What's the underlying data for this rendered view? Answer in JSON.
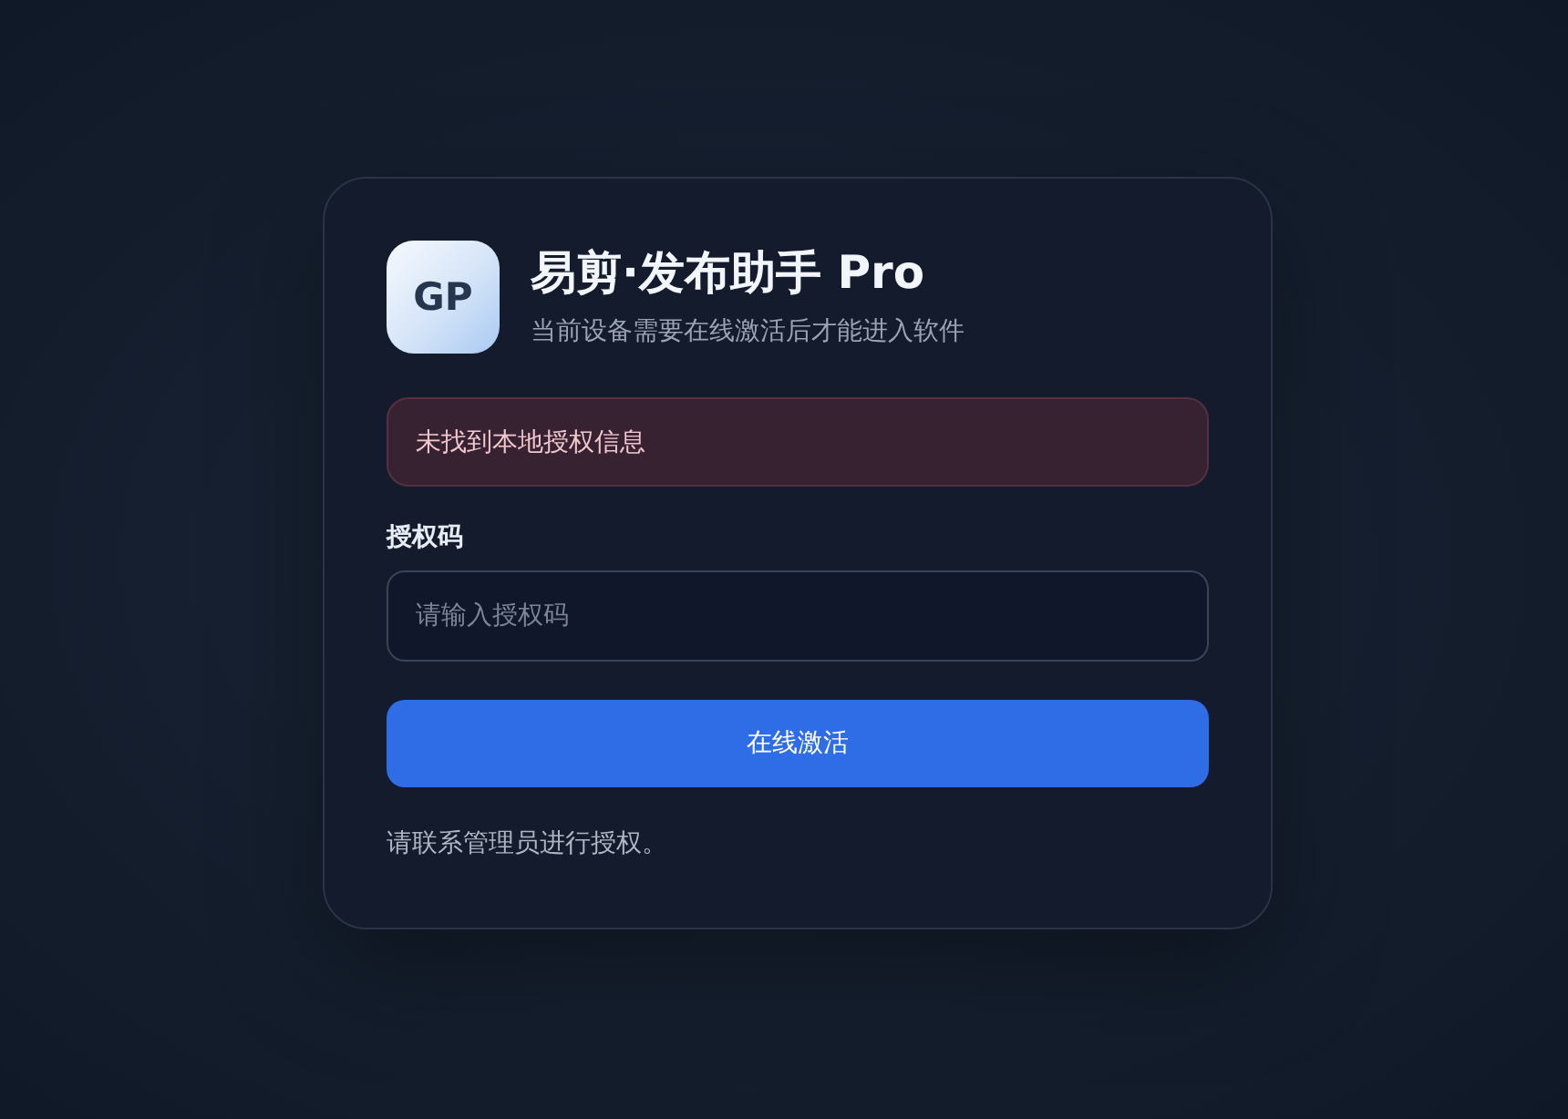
{
  "app": {
    "logo_text": "GP",
    "title": "易剪·发布助手 Pro",
    "subtitle": "当前设备需要在线激活后才能进入软件"
  },
  "alert": {
    "kind": "error",
    "message": "未找到本地授权信息"
  },
  "form": {
    "label": "授权码",
    "placeholder": "请输入授权码"
  },
  "button": {
    "label": "在线激活"
  },
  "footer_note": "请联系管理员进行授权。"
}
